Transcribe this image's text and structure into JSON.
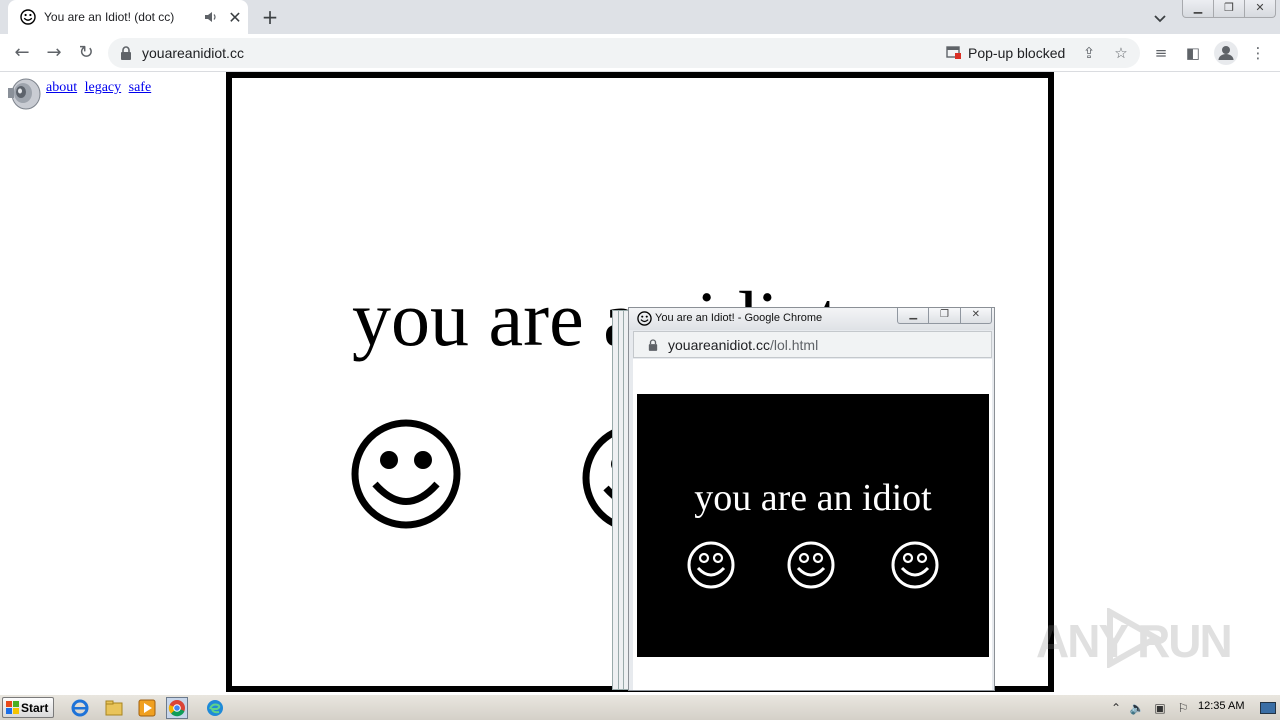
{
  "browser": {
    "tab": {
      "title": "You are an Idiot! (dot cc)",
      "favicon": "smiley-icon",
      "audio": "speaker-icon"
    },
    "new_tab_label": "+",
    "address": {
      "url": "youareanidiot.cc"
    },
    "popup_blocked_label": "Pop-up blocked",
    "window_buttons": [
      "minimize",
      "restore",
      "close"
    ]
  },
  "page": {
    "links": [
      {
        "label": "about"
      },
      {
        "label": "legacy"
      },
      {
        "label": "safe"
      }
    ],
    "headline": "you are an idiot"
  },
  "popup": {
    "title": "You are an Idiot! - Google Chrome",
    "url_host": "youareanidiot.cc",
    "url_path": "/lol.html",
    "text": "you are an idiot"
  },
  "watermark": {
    "text": "ANY RUN"
  },
  "taskbar": {
    "start_label": "Start",
    "clock": "12:35 AM"
  },
  "colors": {
    "tabstrip": "#dee1e6",
    "link": "#0000ee",
    "popup_bg": "#000000"
  }
}
